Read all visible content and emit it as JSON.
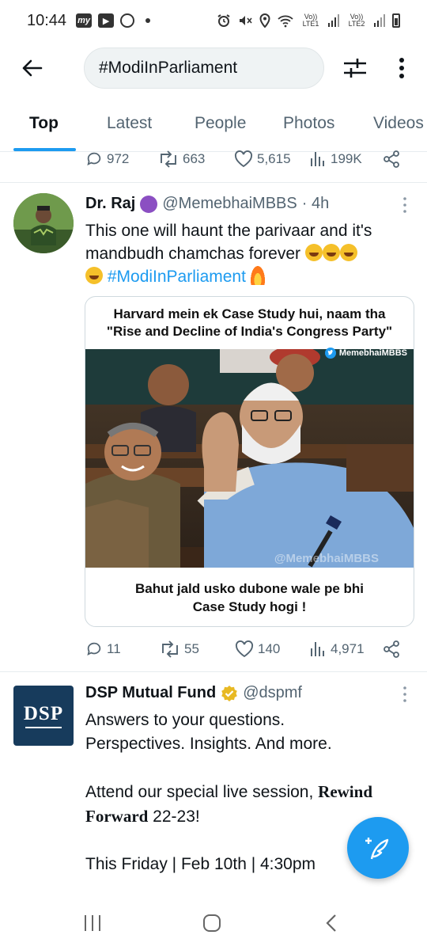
{
  "status_bar": {
    "time": "10:44",
    "left_icons": [
      "my",
      "youtube",
      "pinterest"
    ],
    "right_icons": [
      "alarm-icon",
      "mute-icon",
      "location-icon",
      "wifi-icon",
      "signal-1-icon",
      "signal-2-icon",
      "battery-icon"
    ],
    "sim1_label": "Vo)) LTE1",
    "sim2_label": "Vo)) LTE2"
  },
  "top_bar": {
    "search_query": "#ModiInParliament"
  },
  "tabs": [
    {
      "label": "Top",
      "active": true
    },
    {
      "label": "Latest",
      "active": false
    },
    {
      "label": "People",
      "active": false
    },
    {
      "label": "Photos",
      "active": false
    },
    {
      "label": "Videos",
      "active": false
    }
  ],
  "prev_tweet": {
    "replies": "972",
    "retweets": "663",
    "likes": "5,615",
    "views": "199K"
  },
  "tweet1": {
    "name": "Dr. Raj",
    "handle": "@MemebhaiMBBS",
    "time": "· 4h",
    "text_line1": "This one will haunt the parivaar and it's",
    "text_line2": "mandbudh chamchas forever",
    "hashtag": "#ModiInParliament",
    "media": {
      "top_line1": "Harvard mein ek Case Study hui, naam tha",
      "top_line2": "\"Rise and Decline of India's Congress Party\"",
      "bottom_line1": "Bahut jald usko dubone wale pe bhi",
      "bottom_line2": "Case Study hogi !",
      "watermark_tag": "MemebhaiMBBS",
      "watermark_bottom": "@MemebhaiMBBS"
    },
    "replies": "11",
    "retweets": "55",
    "likes": "140",
    "views": "4,971"
  },
  "tweet2": {
    "name": "DSP Mutual Fund",
    "handle": "@dspmf",
    "logo_text": "DSP",
    "line1": "Answers to your questions.",
    "line2": "Perspectives. Insights. And more.",
    "line3a": "Attend our special live session, ",
    "line3b": "Rewind",
    "line4a": "Forward",
    "line4b": " 22-23!",
    "line5": "This Friday | Feb 10th | 4:30pm"
  },
  "colors": {
    "accent": "#1d9bf0",
    "text": "#0f1419",
    "muted": "#536471",
    "verified_gold": "#e8b923",
    "dsp_navy": "#173b5c"
  }
}
